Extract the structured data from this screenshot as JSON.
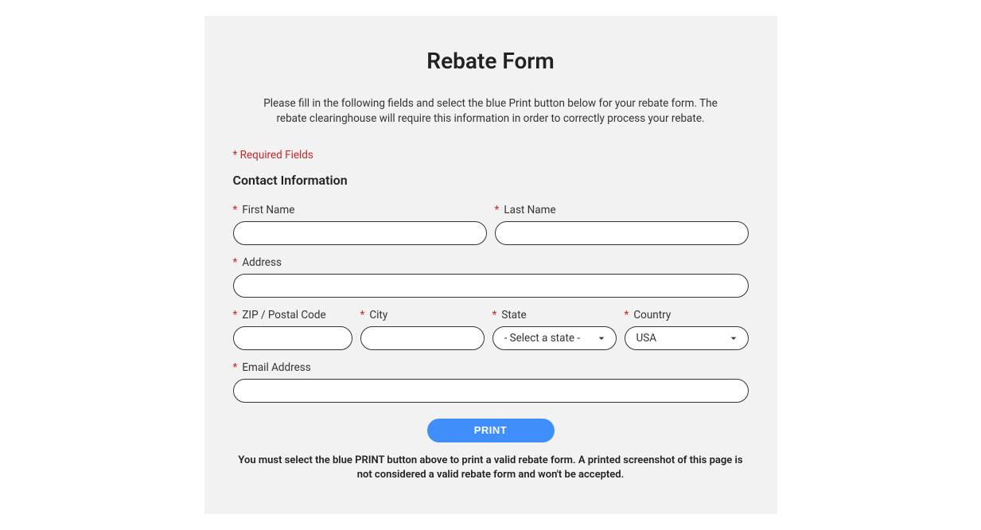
{
  "title": "Rebate Form",
  "description": "Please fill in the following fields and select the blue Print button below for your rebate form. The rebate clearinghouse will require this information in order to correctly process your rebate.",
  "requiredNote": "* Required Fields",
  "sectionHeader": "Contact Information",
  "fields": {
    "firstName": {
      "label": "First Name",
      "value": ""
    },
    "lastName": {
      "label": "Last Name",
      "value": ""
    },
    "address": {
      "label": "Address",
      "value": ""
    },
    "zip": {
      "label": "ZIP / Postal Code",
      "value": ""
    },
    "city": {
      "label": "City",
      "value": ""
    },
    "state": {
      "label": "State",
      "selected": "- Select a state -"
    },
    "country": {
      "label": "Country",
      "selected": "USA"
    },
    "email": {
      "label": "Email Address",
      "value": ""
    }
  },
  "printButton": "PRINT",
  "disclaimer": "You must select the blue PRINT button above to print a valid rebate form. A printed screenshot of this page is not considered a valid rebate form and won't be accepted."
}
